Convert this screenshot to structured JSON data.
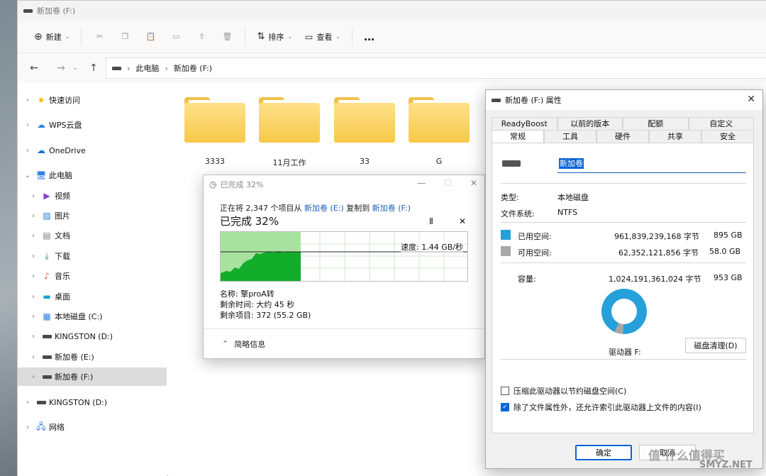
{
  "window": {
    "title": "新加卷 (F:)"
  },
  "toolbar": {
    "new_label": "新建",
    "sort_label": "排序",
    "view_label": "查看",
    "more": "…"
  },
  "address": {
    "segments": [
      "此电脑",
      "新加卷 (F:)"
    ]
  },
  "sidebar": {
    "items": [
      {
        "label": "快速访问"
      },
      {
        "label": "WPS云盘"
      },
      {
        "label": "OneDrive"
      },
      {
        "label": "此电脑"
      },
      {
        "label": "视频"
      },
      {
        "label": "图片"
      },
      {
        "label": "文档"
      },
      {
        "label": "下载"
      },
      {
        "label": "音乐"
      },
      {
        "label": "桌面"
      },
      {
        "label": "本地磁盘 (C:)"
      },
      {
        "label": "KINGSTON (D:)"
      },
      {
        "label": "新加卷 (E:)"
      },
      {
        "label": "新加卷 (F:)"
      },
      {
        "label": "KINGSTON (D:)"
      },
      {
        "label": "网络"
      }
    ]
  },
  "folders": [
    {
      "label": "3333"
    },
    {
      "label": "11月工作"
    },
    {
      "label": "33"
    },
    {
      "label": "G"
    }
  ],
  "copy_dialog": {
    "title": "已完成 32%",
    "line_prefix": "正在将 2,347 个项目从",
    "source": "新加卷 (E:)",
    "middle": "复制到",
    "dest": "新加卷 (F:)",
    "progress_text": "已完成 32%",
    "progress": 0.32,
    "speed": "速度: 1.44 GB/秒",
    "name": "名称: 擎proA转",
    "time_left": "剩余时间: 大约 45 秒",
    "items_left": "剩余项目: 372 (55.2 GB)",
    "summary_label": "简略信息"
  },
  "props_dialog": {
    "title": "新加卷 (F:) 属性",
    "tabs_row1": [
      "ReadyBoost",
      "以前的版本",
      "配额",
      "自定义"
    ],
    "tabs_row2": [
      "常规",
      "工具",
      "硬件",
      "共享",
      "安全"
    ],
    "name_value": "新加卷",
    "type_label": "类型:",
    "type_value": "本地磁盘",
    "fs_label": "文件系统:",
    "fs_value": "NTFS",
    "used_label": "已用空间:",
    "used_bytes": "961,839,239,168 字节",
    "used_gb": "895 GB",
    "free_label": "可用空间:",
    "free_bytes": "62,352,121,856 字节",
    "free_gb": "58.0 GB",
    "cap_label": "容量:",
    "cap_bytes": "1,024,191,361,024 字节",
    "cap_gb": "953 GB",
    "drive_label": "驱动器 F:",
    "cleanup_label": "磁盘清理(D)",
    "compress_label": "压缩此驱动器以节约磁盘空间(C)",
    "index_label": "除了文件属性外，还允许索引此驱动器上文件的内容(I)",
    "ok_label": "确定",
    "cancel_label": "取消",
    "used_color": "#26a0da",
    "free_color": "#a8a8a8",
    "used_fraction": 0.939
  },
  "watermark": {
    "line1": "值 什么值得买",
    "line2": "SMYZ.NET"
  }
}
